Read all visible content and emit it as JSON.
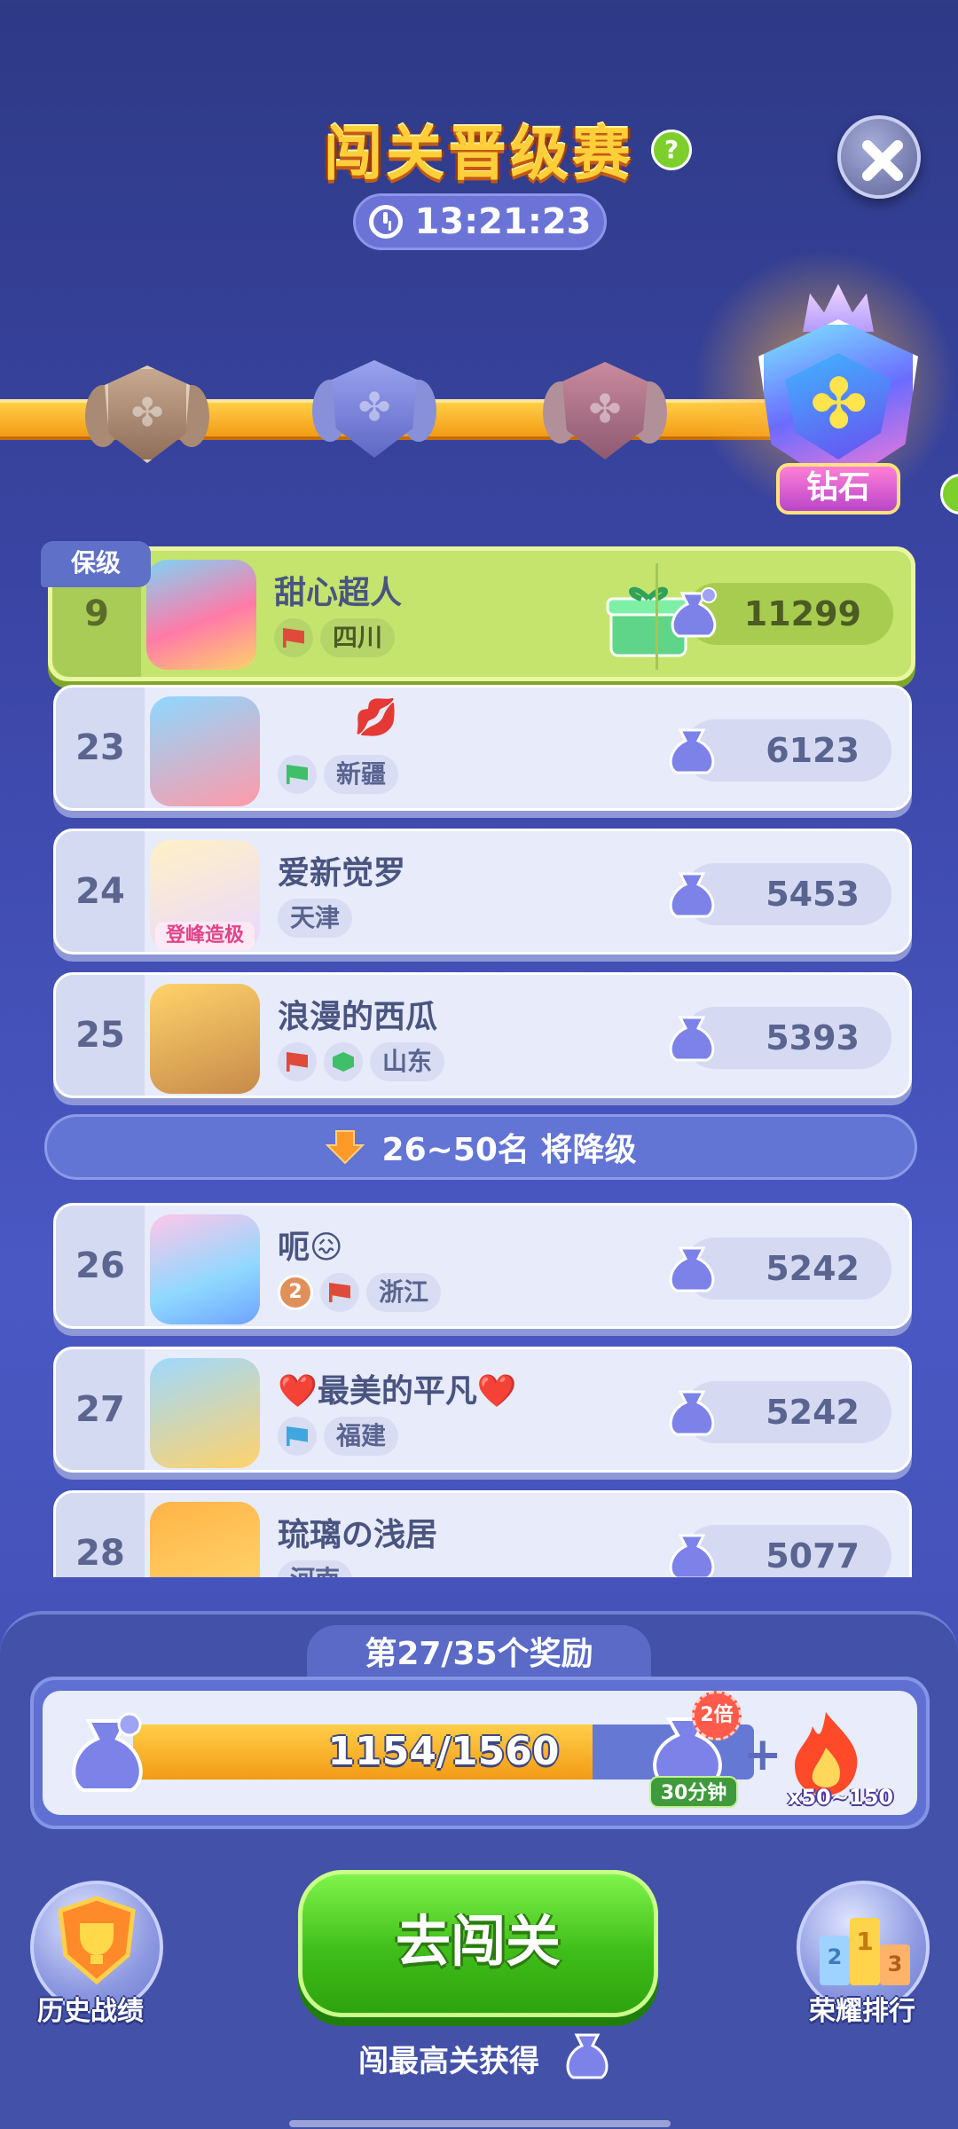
{
  "header": {
    "title": "闯关晋级赛",
    "timer": "13:21:23"
  },
  "tiers": {
    "current_label": "钻石"
  },
  "my_row": {
    "tag": "保级",
    "rank": "9",
    "name": "甜心超人",
    "region": "四川",
    "score": "11299"
  },
  "rows": [
    {
      "rank": "23",
      "name": "",
      "region": "新疆",
      "score": "6123"
    },
    {
      "rank": "24",
      "name": "爱新觉罗",
      "region": "天津",
      "score": "5453",
      "avatar_caption": "登峰造极"
    },
    {
      "rank": "25",
      "name": "浪漫的西瓜",
      "region": "山东",
      "score": "5393"
    },
    {
      "rank": "26",
      "name": "呃😖",
      "region": "浙江",
      "score": "5242",
      "level": "2"
    },
    {
      "rank": "27",
      "name": "❤️最美的平凡❤️",
      "region": "福建",
      "score": "5242"
    },
    {
      "rank": "28",
      "name": "琉璃の浅居",
      "region": "河南",
      "score": "5077"
    }
  ],
  "relegation": {
    "text": "26~50名 将降级"
  },
  "reward": {
    "title": "第27/35个奖励",
    "progress_text": "1154/1560",
    "progress_fraction": 0.74,
    "double_badge": "2倍",
    "duration": "30分钟",
    "fire_amount": "x50~150"
  },
  "buttons": {
    "history": "历史战绩",
    "go": "去闯关",
    "honor": "荣耀排行"
  },
  "hint": "闯最高关获得",
  "colors": {
    "accent_green": "#3fbe19",
    "highlight_row": "#c4e46d",
    "progress_orange": "#f39b15",
    "bg_blue": "#3b46a6"
  }
}
